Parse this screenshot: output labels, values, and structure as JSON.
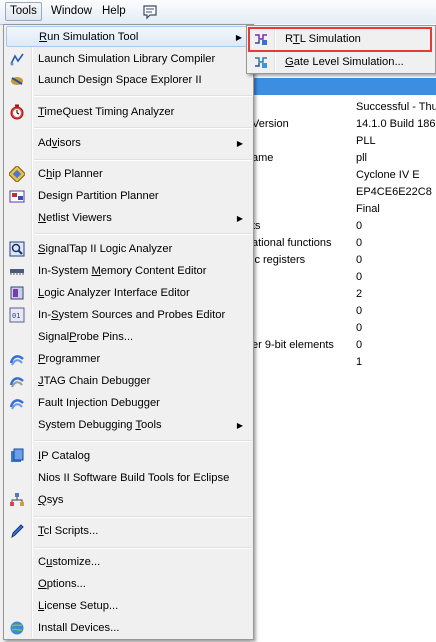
{
  "menubar": {
    "items": [
      "Tools",
      "Window",
      "Help"
    ],
    "icon": "annotation-icon"
  },
  "background": {
    "rows": [
      {
        "label": "",
        "value": "Successful - Thu"
      },
      {
        "label": "Version",
        "value": "14.1.0 Build 186"
      },
      {
        "label": "",
        "value": "PLL"
      },
      {
        "label": "ame",
        "value": "pll"
      },
      {
        "label": "",
        "value": "Cyclone IV E"
      },
      {
        "label": "",
        "value": "EP4CE6E22C8"
      },
      {
        "label": "",
        "value": "Final"
      },
      {
        "label": "ts",
        "value": "0"
      },
      {
        "label": "ational functions",
        "value": "0"
      },
      {
        "label": "ic registers",
        "value": "0"
      },
      {
        "label": "",
        "value": "0"
      },
      {
        "label": "",
        "value": "2"
      },
      {
        "label": "",
        "value": "0"
      },
      {
        "label": "",
        "value": "0"
      },
      {
        "label": "er 9-bit elements",
        "value": "0"
      },
      {
        "label": "",
        "value": "1"
      }
    ]
  },
  "tools_menu": {
    "items": [
      {
        "label": "Run Simulation Tool",
        "icon": "",
        "submenu": true
      },
      {
        "label": "Launch Simulation Library Compiler",
        "icon": "library-compiler-icon"
      },
      {
        "label": "Launch Design Space Explorer II",
        "icon": "dse-icon"
      },
      {
        "label": "TimeQuest Timing Analyzer",
        "icon": "stopwatch-icon"
      },
      {
        "label": "Advisors",
        "icon": "",
        "submenu": true
      },
      {
        "label": "Chip Planner",
        "icon": "chip-planner-icon"
      },
      {
        "label": "Design Partition Planner",
        "icon": "partition-planner-icon"
      },
      {
        "label": "Netlist Viewers",
        "icon": "",
        "submenu": true
      },
      {
        "label": "SignalTap II Logic Analyzer",
        "icon": "signaltap-icon"
      },
      {
        "label": "In-System Memory Content Editor",
        "icon": "memory-editor-icon"
      },
      {
        "label": "Logic Analyzer Interface Editor",
        "icon": "logic-analyzer-interface-icon"
      },
      {
        "label": "In-System Sources and Probes Editor",
        "icon": "sources-probes-icon"
      },
      {
        "label": "SignalProbe Pins...",
        "icon": ""
      },
      {
        "label": "Programmer",
        "icon": "programmer-icon"
      },
      {
        "label": "JTAG Chain Debugger",
        "icon": "jtag-debugger-icon"
      },
      {
        "label": "Fault Injection Debugger",
        "icon": "fault-injection-icon"
      },
      {
        "label": "System Debugging Tools",
        "icon": "",
        "submenu": true
      },
      {
        "label": "IP Catalog",
        "icon": "ip-catalog-icon"
      },
      {
        "label": "Nios II Software Build Tools for Eclipse",
        "icon": ""
      },
      {
        "label": "Qsys",
        "icon": "qsys-icon"
      },
      {
        "label": "Tcl Scripts...",
        "icon": "tcl-pen-icon"
      },
      {
        "label": "Customize...",
        "icon": ""
      },
      {
        "label": "Options...",
        "icon": ""
      },
      {
        "label": "License Setup...",
        "icon": ""
      },
      {
        "label": "Install Devices...",
        "icon": "install-devices-icon"
      }
    ]
  },
  "simulation_submenu": {
    "items": [
      {
        "label": "RTL Simulation",
        "icon": "rtl-simulation-icon"
      },
      {
        "label": "Gate Level Simulation...",
        "icon": "gate-level-simulation-icon"
      }
    ],
    "highlight_color": "#e53a3a"
  }
}
